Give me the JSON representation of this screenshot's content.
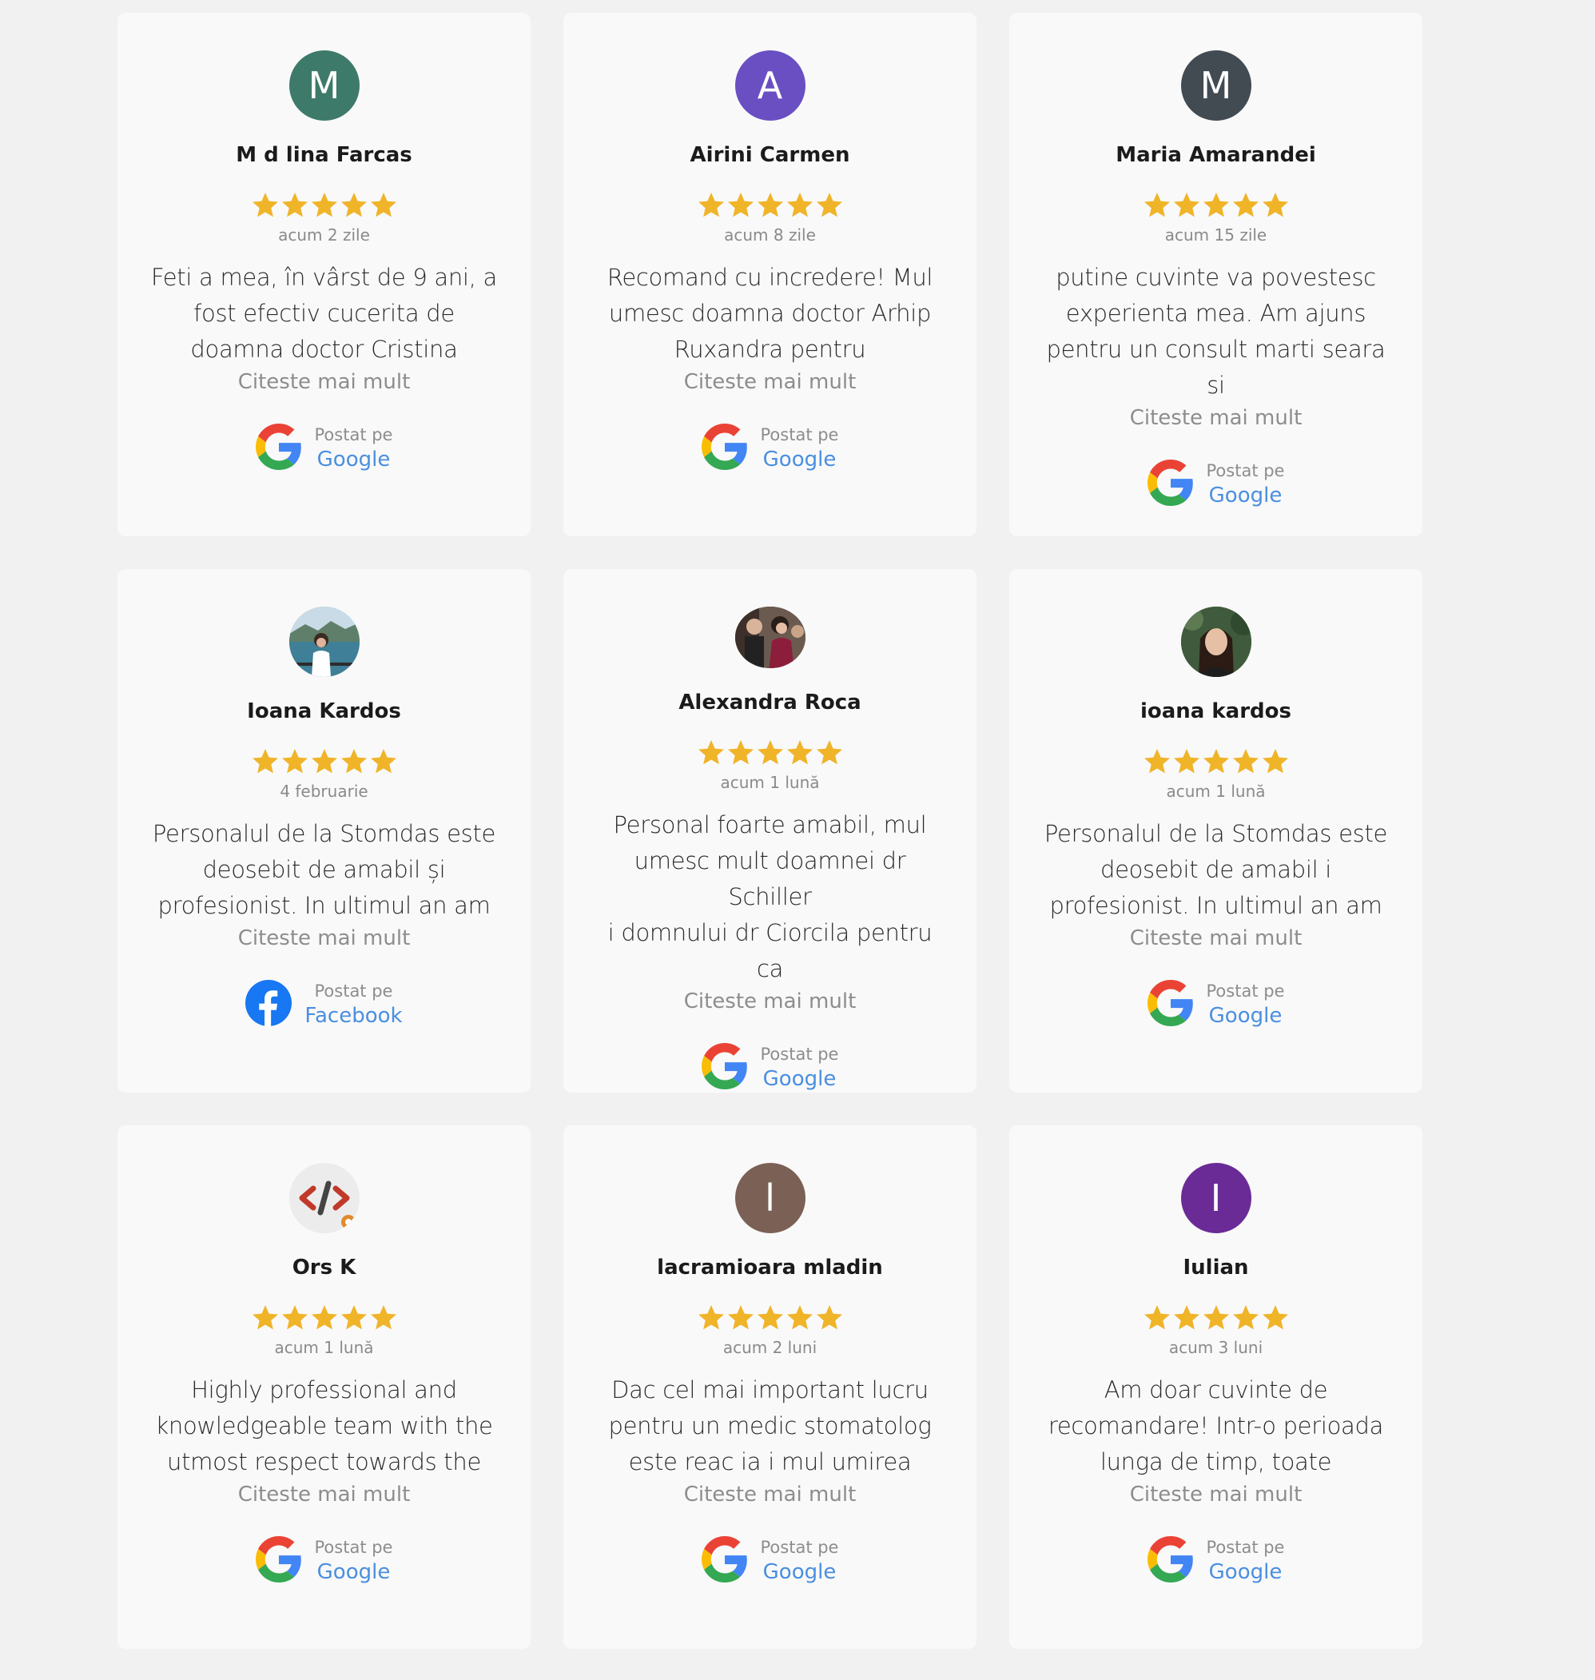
{
  "colors": {
    "star": "#f0b429",
    "link": "#4a8fe0",
    "card_bg": "#f9f9f9",
    "page_bg": "#f1f1f1"
  },
  "more_label": "Citeste mai mult",
  "posted_label": "Postat pe",
  "reviews": [
    {
      "name": "M d lina Farcas",
      "avatar_letter": "M",
      "avatar_color": "#3e7a69",
      "avatar_type": "letter",
      "rating": 5,
      "date": "acum 2 zile",
      "lines": [
        "Feti a mea, în vârst de 9 ani, a",
        "fost efectiv cucerita de",
        "doamna doctor Cristina"
      ],
      "platform": "Google"
    },
    {
      "name": "Airini Carmen",
      "avatar_letter": "A",
      "avatar_color": "#6a4fc3",
      "avatar_type": "letter",
      "rating": 5,
      "date": "acum 8 zile",
      "lines": [
        "Recomand cu incredere! Mul",
        "umesc doamna doctor Arhip",
        "Ruxandra pentru"
      ],
      "platform": "Google"
    },
    {
      "name": "Maria Amarandei",
      "avatar_letter": "M",
      "avatar_color": "#424a52",
      "avatar_type": "letter",
      "rating": 5,
      "date": "acum 15 zile",
      "lines": [
        "putine cuvinte va povestesc",
        "experienta mea. Am ajuns",
        "pentru un consult marti seara si"
      ],
      "platform": "Google"
    },
    {
      "name": "Ioana Kardos",
      "avatar_letter": "",
      "avatar_color": "#8fb3c9",
      "avatar_type": "photo-lake",
      "rating": 5,
      "date": "4 februarie",
      "lines": [
        "Personalul de la Stomdas este",
        "deosebit de amabil și",
        "profesionist. In ultimul an am"
      ],
      "platform": "Facebook"
    },
    {
      "name": "Alexandra Roca",
      "avatar_letter": "",
      "avatar_color": "#5a3b34",
      "avatar_type": "photo-group",
      "rating": 5,
      "date": "acum 1 lună",
      "lines": [
        "Personal foarte amabil, mul",
        "umesc mult doamnei dr Schiller",
        "i domnului dr Ciorcila pentru ca"
      ],
      "platform": "Google"
    },
    {
      "name": "ioana kardos",
      "avatar_letter": "",
      "avatar_color": "#3d5a3a",
      "avatar_type": "photo-portrait",
      "rating": 5,
      "date": "acum 1 lună",
      "lines": [
        "Personalul de la Stomdas este",
        "deosebit de amabil i",
        "profesionist. In ultimul an am"
      ],
      "platform": "Google"
    },
    {
      "name": "Ors K",
      "avatar_letter": "",
      "avatar_color": "#eeeeee",
      "avatar_type": "code",
      "rating": 5,
      "date": "acum 1 lună",
      "lines": [
        "Highly professional and",
        "knowledgeable team with the",
        "utmost respect towards the"
      ],
      "platform": "Google"
    },
    {
      "name": "lacramioara mladin",
      "avatar_letter": "l",
      "avatar_color": "#7a6055",
      "avatar_type": "letter",
      "rating": 5,
      "date": "acum 2 luni",
      "lines": [
        "Dac cel mai important lucru",
        "pentru un medic stomatolog",
        "este reac ia i mul umirea"
      ],
      "platform": "Google"
    },
    {
      "name": "Iulian",
      "avatar_letter": "I",
      "avatar_color": "#6a2b96",
      "avatar_type": "letter",
      "rating": 5,
      "date": "acum 3 luni",
      "lines": [
        "Am doar cuvinte de",
        "recomandare! Intr-o perioada",
        "lunga de timp, toate"
      ],
      "platform": "Google"
    }
  ]
}
